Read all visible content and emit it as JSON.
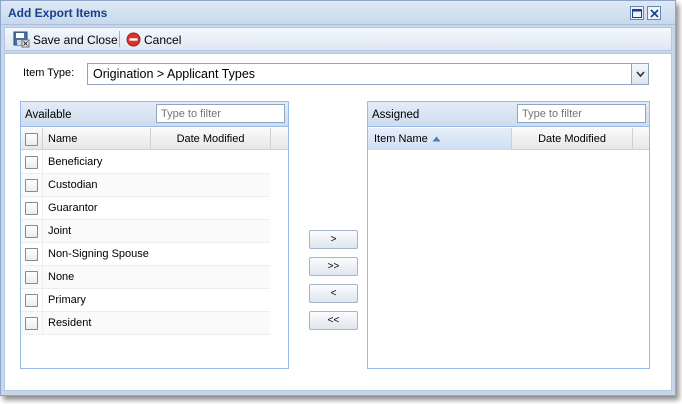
{
  "window": {
    "title": "Add Export Items"
  },
  "toolbar": {
    "save_label": "Save and Close",
    "cancel_label": "Cancel"
  },
  "item_type": {
    "label": "Item Type:",
    "value": "Origination > Applicant Types"
  },
  "available": {
    "title": "Available",
    "filter_placeholder": "Type to filter",
    "columns": {
      "name": "Name",
      "date_modified": "Date Modified"
    },
    "items": [
      {
        "name": "Beneficiary"
      },
      {
        "name": "Custodian"
      },
      {
        "name": "Guarantor"
      },
      {
        "name": "Joint"
      },
      {
        "name": "Non-Signing Spouse"
      },
      {
        "name": "None"
      },
      {
        "name": "Primary"
      },
      {
        "name": "Resident"
      }
    ]
  },
  "assigned": {
    "title": "Assigned",
    "filter_placeholder": "Type to filter",
    "columns": {
      "name": "Item Name",
      "date_modified": "Date Modified"
    },
    "sort": "ascending"
  },
  "move_buttons": {
    "add_selected": ">",
    "add_all": ">>",
    "remove_selected": "<",
    "remove_all": "<<"
  },
  "colors": {
    "title_text": "#15428b",
    "panel_border": "#99bbe8",
    "cancel_red": "#d9342b"
  }
}
